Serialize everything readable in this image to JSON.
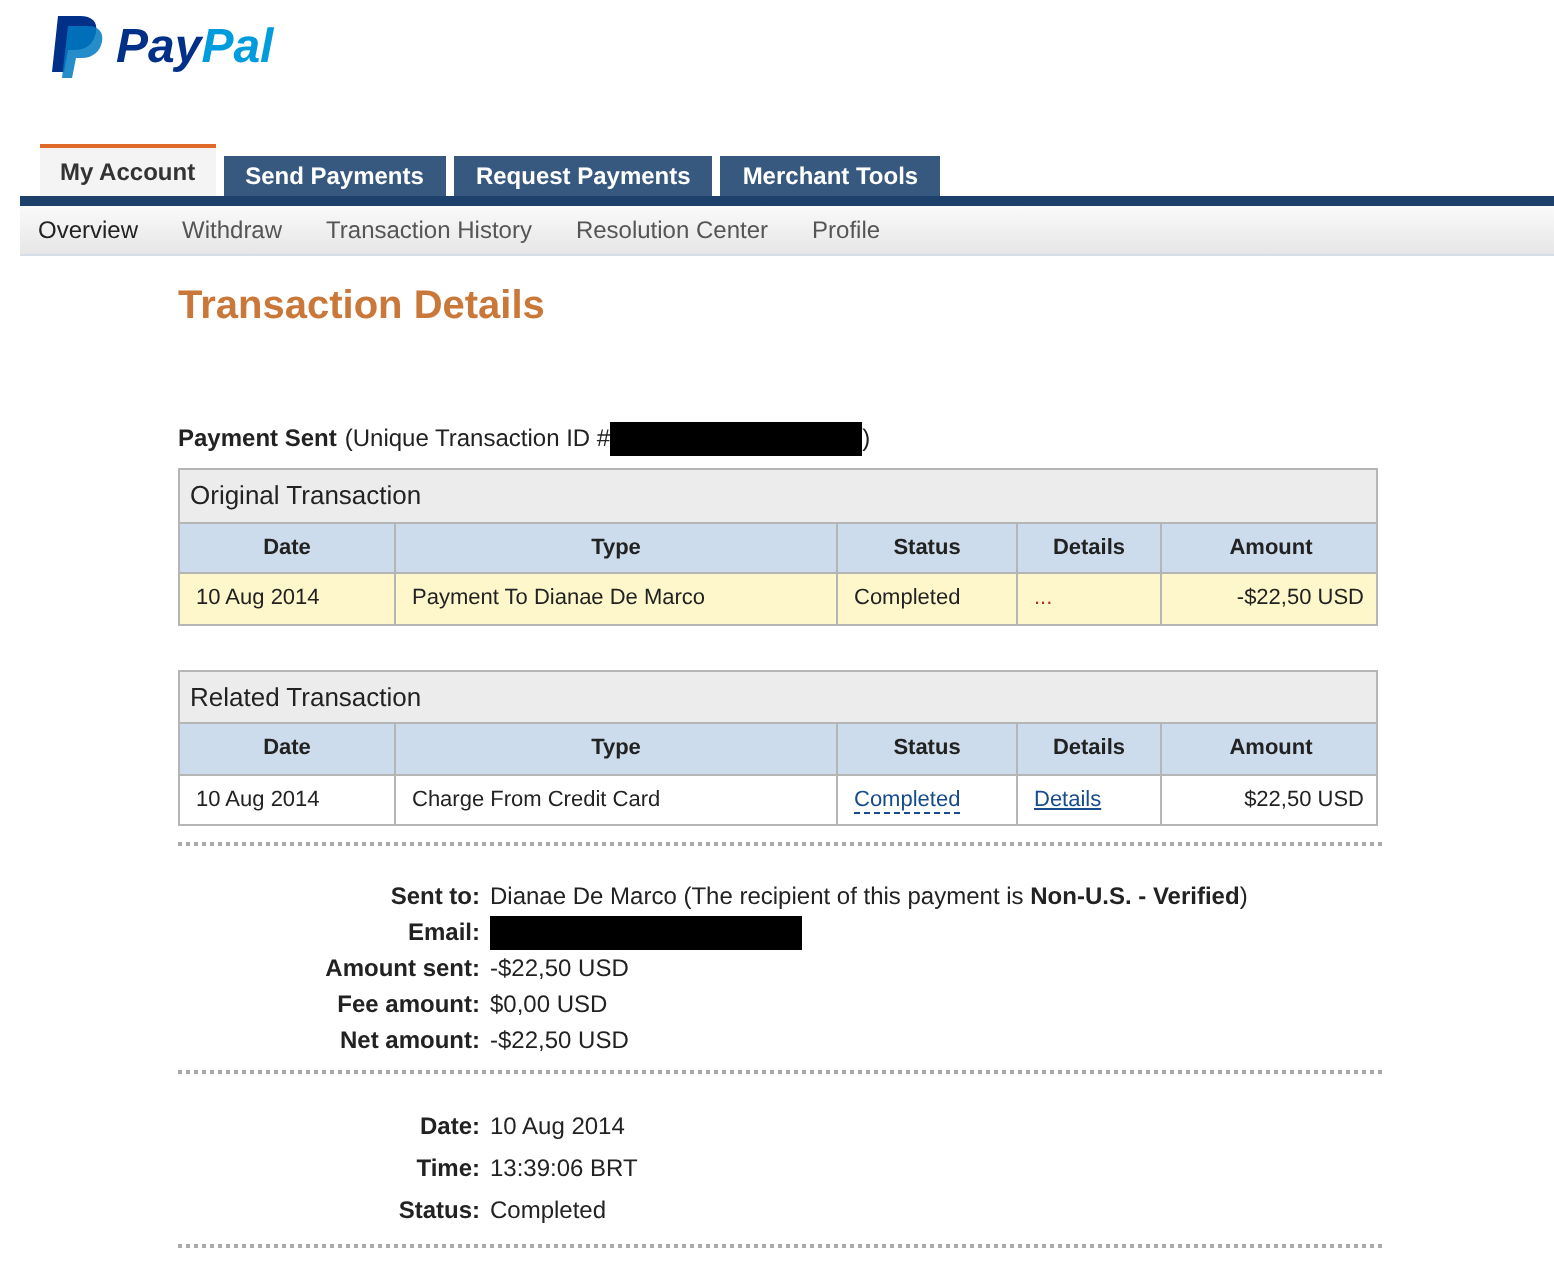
{
  "logo": {
    "part_1": "Pay",
    "part_2": "Pal"
  },
  "tabs": [
    {
      "label": "My Account",
      "selected": true
    },
    {
      "label": "Send Payments",
      "selected": false
    },
    {
      "label": "Request Payments",
      "selected": false
    },
    {
      "label": "Merchant Tools",
      "selected": false
    }
  ],
  "subnav": [
    {
      "label": "Overview",
      "selected": true
    },
    {
      "label": "Withdraw",
      "selected": false
    },
    {
      "label": "Transaction History",
      "selected": false
    },
    {
      "label": "Resolution Center",
      "selected": false
    },
    {
      "label": "Profile",
      "selected": false
    }
  ],
  "page_title": "Transaction Details",
  "payment_heading": {
    "label": "Payment Sent",
    "id_prefix": "(Unique Transaction ID #",
    "id_suffix": ")",
    "id_redacted": true
  },
  "tables": [
    {
      "title": "Original Transaction",
      "columns": [
        "Date",
        "Type",
        "Status",
        "Details",
        "Amount"
      ],
      "rows": [
        {
          "highlighted": true,
          "date": "10 Aug 2014",
          "type": "Payment To Dianae De Marco",
          "status": {
            "text": "Completed",
            "kind": "plain"
          },
          "details": {
            "text": "...",
            "kind": "plain"
          },
          "amount": "-$22,50 USD"
        }
      ]
    },
    {
      "title": "Related Transaction",
      "columns": [
        "Date",
        "Type",
        "Status",
        "Details",
        "Amount"
      ],
      "rows": [
        {
          "highlighted": false,
          "date": "10 Aug 2014",
          "type": "Charge From Credit Card",
          "status": {
            "text": "Completed",
            "kind": "tooltip"
          },
          "details": {
            "text": "Details",
            "kind": "link"
          },
          "amount": "$22,50 USD"
        }
      ]
    }
  ],
  "sections": [
    [
      {
        "label": "Sent to:",
        "kind": "text",
        "value": "Dianae De Marco (The recipient of this payment is **Non-U.S. - Verified**)"
      },
      {
        "label": "Email:",
        "kind": "redacted"
      },
      {
        "label": "Amount sent:",
        "kind": "text",
        "value": "-$22,50 USD"
      },
      {
        "label": "Fee amount:",
        "kind": "text",
        "value": "$0,00 USD"
      },
      {
        "label": "Net amount:",
        "kind": "text",
        "value": "-$22,50 USD"
      }
    ],
    [
      {
        "label": "Date:",
        "kind": "text",
        "value": "10 Aug 2014"
      },
      {
        "label": "Time:",
        "kind": "text",
        "value": "13:39:06 BRT"
      },
      {
        "label": "Status:",
        "kind": "text",
        "value": "Completed"
      }
    ]
  ]
}
